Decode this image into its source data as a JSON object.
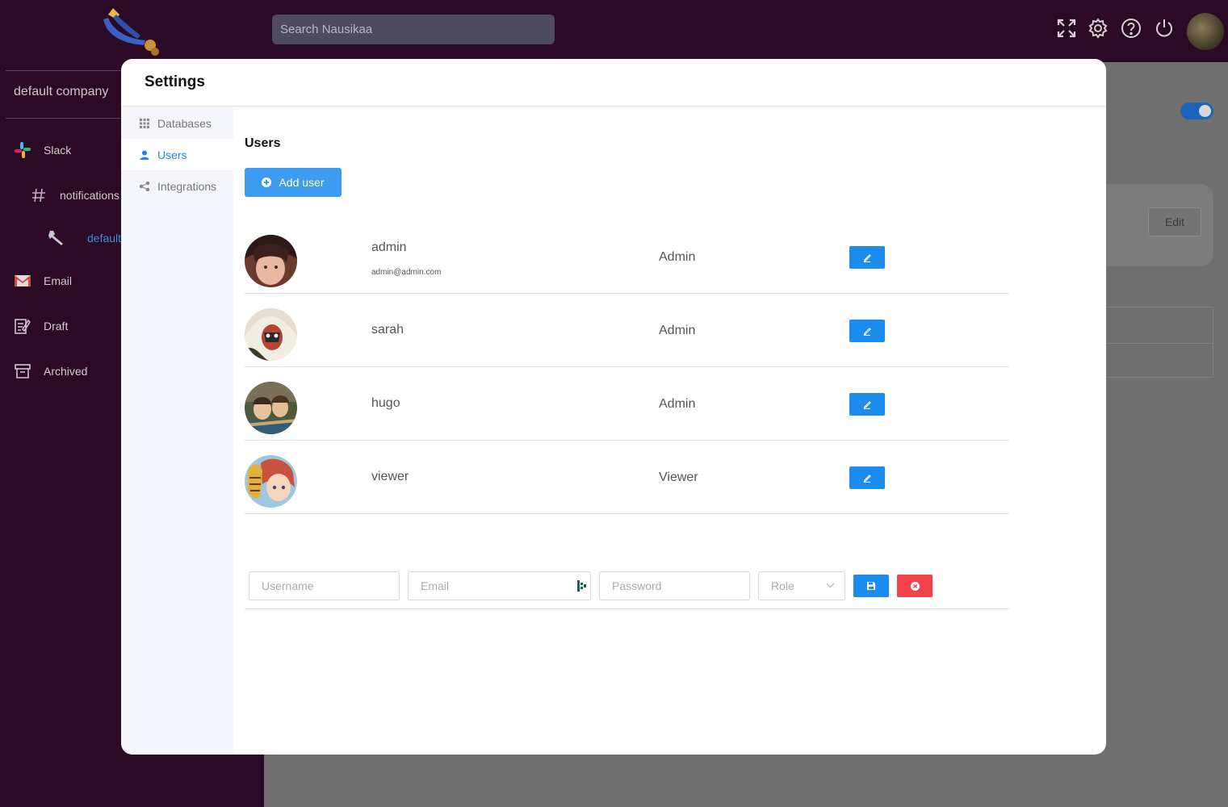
{
  "app": {
    "search_placeholder": "Search Nausikaa",
    "company": "default company",
    "sidebar": [
      {
        "label": "Slack",
        "icon": "slack-icon"
      },
      {
        "label": "notifications",
        "icon": "hash-icon"
      },
      {
        "label": "default",
        "icon": "wrench-icon"
      },
      {
        "label": "Email",
        "icon": "gmail-icon"
      },
      {
        "label": "Draft",
        "icon": "draft-icon"
      },
      {
        "label": "Archived",
        "icon": "archive-icon"
      }
    ],
    "edit_label": "Edit"
  },
  "modal": {
    "title": "Settings",
    "nav": [
      {
        "label": "Databases",
        "icon": "grid-icon"
      },
      {
        "label": "Users",
        "icon": "user-icon"
      },
      {
        "label": "Integrations",
        "icon": "share-icon"
      }
    ],
    "panel_title": "Users",
    "add_user_label": "Add user",
    "users": [
      {
        "name": "admin",
        "email": "admin@admin.com",
        "role": "Admin"
      },
      {
        "name": "sarah",
        "email": "",
        "role": "Admin"
      },
      {
        "name": "hugo",
        "email": "",
        "role": "Admin"
      },
      {
        "name": "viewer",
        "email": "",
        "role": "Viewer"
      }
    ],
    "form": {
      "username_placeholder": "Username",
      "email_placeholder": "Email",
      "password_placeholder": "Password",
      "role_placeholder": "Role"
    }
  },
  "colors": {
    "sidebar_bg": "#2a0a24",
    "primary": "#1c8cf0",
    "danger": "#f2414a"
  }
}
